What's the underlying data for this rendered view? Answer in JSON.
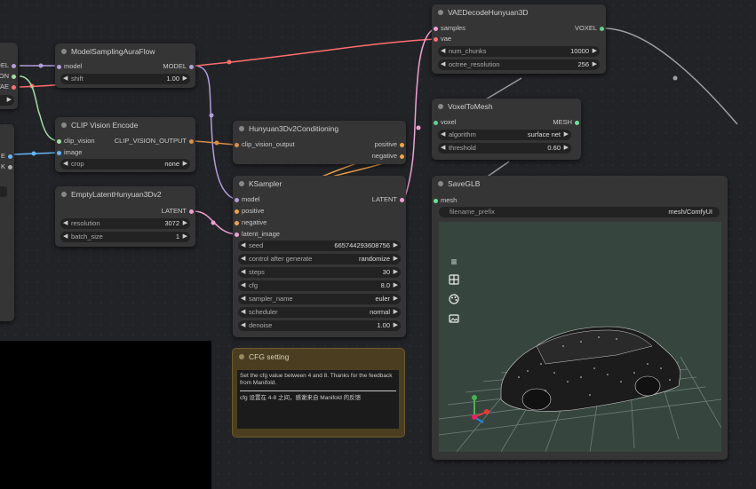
{
  "colors": {
    "model": "#b39ddb",
    "clip_vision": "#a1dfa4",
    "clip_vision_output": "#d98e4a",
    "conditioning": "#f0a44a",
    "latent": "#f0a0d0",
    "vae": "#ff6e6e",
    "voxel": "#5fd08a",
    "mesh": "#6ee29a",
    "image": "#64b5f6",
    "wire_grey": "#9a9a9a"
  },
  "left_partial": {
    "outputs": [
      "MODEL",
      "VISION",
      "VAE"
    ],
    "inputs": [
      "E",
      "K"
    ]
  },
  "model_sampling": {
    "title": "ModelSamplingAuraFlow",
    "input": "model",
    "output": "MODEL",
    "shift_label": "shift",
    "shift_value": "1.00"
  },
  "clip_vision_encode": {
    "title": "CLIP Vision Encode",
    "inputs": [
      "clip_vision",
      "image"
    ],
    "output": "CLIP_VISION_OUTPUT",
    "crop_label": "crop",
    "crop_value": "none"
  },
  "empty_latent": {
    "title": "EmptyLatentHunyuan3Dv2",
    "output": "LATENT",
    "resolution_label": "resolution",
    "resolution_value": "3072",
    "batch_label": "batch_size",
    "batch_value": "1"
  },
  "conditioning": {
    "title": "Hunyuan3Dv2Conditioning",
    "input": "clip_vision_output",
    "outputs": [
      "positive",
      "negative"
    ]
  },
  "ksampler": {
    "title": "KSampler",
    "inputs": [
      "model",
      "positive",
      "negative",
      "latent_image"
    ],
    "output": "LATENT",
    "widgets": [
      {
        "label": "seed",
        "value": "665744293608756"
      },
      {
        "label": "control after generate",
        "value": "randomize"
      },
      {
        "label": "steps",
        "value": "30"
      },
      {
        "label": "cfg",
        "value": "8.0"
      },
      {
        "label": "sampler_name",
        "value": "euler"
      },
      {
        "label": "scheduler",
        "value": "normal"
      },
      {
        "label": "denoise",
        "value": "1.00"
      }
    ]
  },
  "cfg_note": {
    "title": "CFG setting",
    "line1": "Set the cfg value between 4 and 8. Thanks for the feedback from Manifold.",
    "line2": "cfg 设置在 4-8 之间，感谢来自 Manifold 的反馈"
  },
  "vae_decode": {
    "title": "VAEDecodeHunyuan3D",
    "inputs": [
      "samples",
      "vae"
    ],
    "output": "VOXEL",
    "widgets": [
      {
        "label": "num_chunks",
        "value": "10000"
      },
      {
        "label": "octree_resolution",
        "value": "256"
      }
    ]
  },
  "voxel_to_mesh": {
    "title": "VoxelToMesh",
    "input": "voxel",
    "output": "MESH",
    "widgets": [
      {
        "label": "algorithm",
        "value": "surface net"
      },
      {
        "label": "threshold",
        "value": "0.60"
      }
    ]
  },
  "save_glb": {
    "title": "SaveGLB",
    "input": "mesh",
    "prefix_label": "filename_prefix",
    "prefix_value": "mesh/ComfyUI",
    "toolbar_icons": [
      "menu-icon",
      "grid-icon",
      "palette-icon",
      "image-icon"
    ]
  }
}
